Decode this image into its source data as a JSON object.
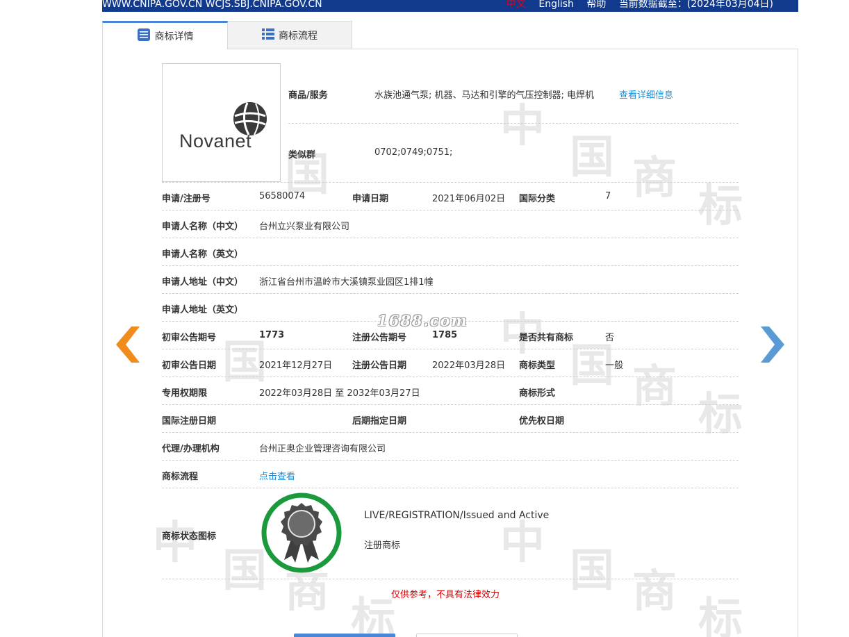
{
  "topbar": {
    "site_urls": "WWW.CNIPA.GOV.CN WCJS.SBJ.CNIPA.GOV.CN",
    "lang_zh": "中文",
    "lang_en": "English",
    "help": "帮助",
    "data_date": "当前数据截至：(2024年03月04日)"
  },
  "tabs": [
    {
      "label": "商标详情",
      "icon": "document-list-icon",
      "active": true
    },
    {
      "label": "商标流程",
      "icon": "list-icon",
      "active": false
    }
  ],
  "logo": {
    "text": "Novanet",
    "icon": "globe-icon"
  },
  "goods": {
    "label": "商品/服务",
    "value": "水族池通气泵; 机器、马达和引擎的气压控制器; 电焊机",
    "link": "查看详细信息"
  },
  "similar_group": {
    "label": "类似群",
    "value": "0702;0749;0751;"
  },
  "fields": {
    "reg_no_label": "申请/注册号",
    "reg_no": "56580074",
    "app_date_label": "申请日期",
    "app_date": "2021年06月02日",
    "intl_class_label": "国际分类",
    "intl_class": "7",
    "applicant_cn_label": "申请人名称（中文）",
    "applicant_cn": "台州立兴泵业有限公司",
    "applicant_en_label": "申请人名称（英文）",
    "applicant_en": "",
    "address_cn_label": "申请人地址（中文）",
    "address_cn": "浙江省台州市温岭市大溪镇泵业园区1排1幢",
    "address_en_label": "申请人地址（英文）",
    "address_en": "",
    "prelim_issue_label": "初审公告期号",
    "prelim_issue": "1773",
    "reg_issue_label": "注册公告期号",
    "reg_issue": "1785",
    "shared_label": "是否共有商标",
    "shared": "否",
    "prelim_date_label": "初审公告日期",
    "prelim_date": "2021年12月27日",
    "reg_date_label": "注册公告日期",
    "reg_date": "2022年03月28日",
    "tm_type_label": "商标类型",
    "tm_type": "一般",
    "exclusive_label": "专用权期限",
    "exclusive": "2022年03月28日 至 2032年03月27日",
    "tm_form_label": "商标形式",
    "tm_form": "",
    "intl_reg_date_label": "国际注册日期",
    "intl_reg_date": "",
    "later_date_label": "后期指定日期",
    "later_date": "",
    "priority_date_label": "优先权日期",
    "priority_date": "",
    "agent_label": "代理/办理机构",
    "agent": "台州正奥企业管理咨询有限公司",
    "process_label": "商标流程",
    "process_link": "点击查看",
    "status_icon_label": "商标状态图标"
  },
  "status": {
    "en": "LIVE/REGISTRATION/Issued and Active",
    "cn": "注册商标",
    "icon": "award-ribbon-icon",
    "ring_color": "#1a9a3c"
  },
  "disclaimer": "仅供参考，不具有法律效力",
  "overlay_watermark": "1688.com",
  "colors": {
    "topbar": "#123a8c",
    "accent": "#4a86d6",
    "link": "#1a8ed6",
    "arrow_left": "#f08c1e",
    "arrow_right": "#5b9bd5",
    "disclaimer": "#d40000"
  }
}
